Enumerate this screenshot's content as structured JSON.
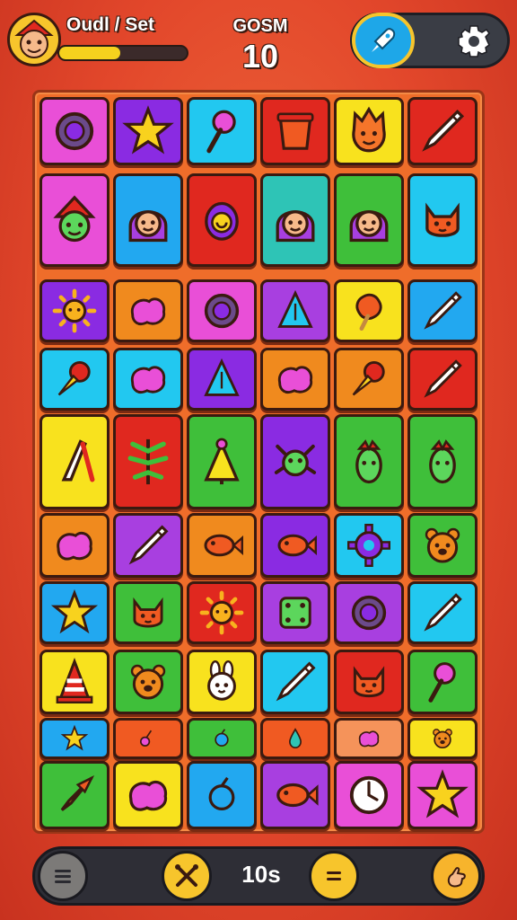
{
  "hud": {
    "player_name": "Oudl / Set",
    "xp_progress": 0.48,
    "score_label": "GOSM",
    "score_value": "10",
    "rocket_icon": "rocket-icon",
    "settings_icon": "gear-icon"
  },
  "board": {
    "rows": [
      [
        {
          "color": "#e94fd7",
          "icon": "ring"
        },
        {
          "color": "#8a2be2",
          "icon": "star"
        },
        {
          "color": "#22c8f0",
          "icon": "lollipop"
        },
        {
          "color": "#e0281f",
          "icon": "bucket"
        },
        {
          "color": "#f8e21e",
          "icon": "flame-face"
        },
        {
          "color": "#e0281f",
          "icon": "pencil"
        }
      ],
      [
        {
          "color": "#e94fd7",
          "icon": "elf-face"
        },
        {
          "color": "#22a8f0",
          "icon": "girl-face"
        },
        {
          "color": "#e0281f",
          "icon": "snail"
        },
        {
          "color": "#2ec4b6",
          "icon": "girl-face"
        },
        {
          "color": "#3fbf3a",
          "icon": "girl-face"
        },
        {
          "color": "#22c8f0",
          "icon": "cat-face"
        }
      ],
      [
        {
          "color": "#8a2be2",
          "icon": "sun"
        },
        {
          "color": "#f08a1e",
          "icon": "blob"
        },
        {
          "color": "#e94fd7",
          "icon": "ring"
        },
        {
          "color": "#a83fe0",
          "icon": "triangle"
        },
        {
          "color": "#f8e21e",
          "icon": "popsicle"
        },
        {
          "color": "#22a8f0",
          "icon": "pencil"
        }
      ],
      [
        {
          "color": "#22c8f0",
          "icon": "ice-cream"
        },
        {
          "color": "#22c8f0",
          "icon": "blob"
        },
        {
          "color": "#8a2be2",
          "icon": "triangle"
        },
        {
          "color": "#f08a1e",
          "icon": "blob"
        },
        {
          "color": "#f08a1e",
          "icon": "ice-cream"
        },
        {
          "color": "#e0281f",
          "icon": "pencil"
        }
      ],
      [
        {
          "color": "#f8e21e",
          "icon": "blade"
        },
        {
          "color": "#e0281f",
          "icon": "leaf"
        },
        {
          "color": "#3fbf3a",
          "icon": "tree"
        },
        {
          "color": "#8a2be2",
          "icon": "bug"
        },
        {
          "color": "#3fbf3a",
          "icon": "cactus"
        },
        {
          "color": "#3fbf3a",
          "icon": "cactus"
        }
      ],
      [
        {
          "color": "#f08a1e",
          "icon": "blob"
        },
        {
          "color": "#a83fe0",
          "icon": "pencil"
        },
        {
          "color": "#f08a1e",
          "icon": "fish"
        },
        {
          "color": "#8a2be2",
          "icon": "fish"
        },
        {
          "color": "#22c8f0",
          "icon": "gear"
        },
        {
          "color": "#3fbf3a",
          "icon": "bear"
        }
      ],
      [
        {
          "color": "#22a8f0",
          "icon": "star"
        },
        {
          "color": "#3fbf3a",
          "icon": "cat-face"
        },
        {
          "color": "#e0281f",
          "icon": "sun"
        },
        {
          "color": "#a83fe0",
          "icon": "dice"
        },
        {
          "color": "#a83fe0",
          "icon": "ring"
        },
        {
          "color": "#22c8f0",
          "icon": "pencil"
        }
      ],
      [
        {
          "color": "#f8e21e",
          "icon": "cone"
        },
        {
          "color": "#3fbf3a",
          "icon": "bear"
        },
        {
          "color": "#f8e21e",
          "icon": "bunny"
        },
        {
          "color": "#22c8f0",
          "icon": "pencil"
        },
        {
          "color": "#e0281f",
          "icon": "cat-face"
        },
        {
          "color": "#3fbf3a",
          "icon": "lollipop"
        }
      ],
      [
        {
          "color": "#22a8f0",
          "icon": "star"
        },
        {
          "color": "#f05a22",
          "icon": "cherry"
        },
        {
          "color": "#3fbf3a",
          "icon": "berry"
        },
        {
          "color": "#f05a22",
          "icon": "drop"
        },
        {
          "color": "#f5935a",
          "icon": "blob"
        },
        {
          "color": "#f8e21e",
          "icon": "bear"
        }
      ],
      [
        {
          "color": "#3fbf3a",
          "icon": "rocket"
        },
        {
          "color": "#f8e21e",
          "icon": "blob"
        },
        {
          "color": "#22a8f0",
          "icon": "berry"
        },
        {
          "color": "#a83fe0",
          "icon": "fish"
        },
        {
          "color": "#e94fd7",
          "icon": "clock"
        },
        {
          "color": "#e94fd7",
          "icon": "star"
        }
      ]
    ]
  },
  "bottom_bar": {
    "menu_icon": "menu-icon",
    "shuffle_icon": "cross-tools-icon",
    "moves_text": "10s",
    "list_icon": "list-icon",
    "hint_icon": "hand-icon"
  }
}
